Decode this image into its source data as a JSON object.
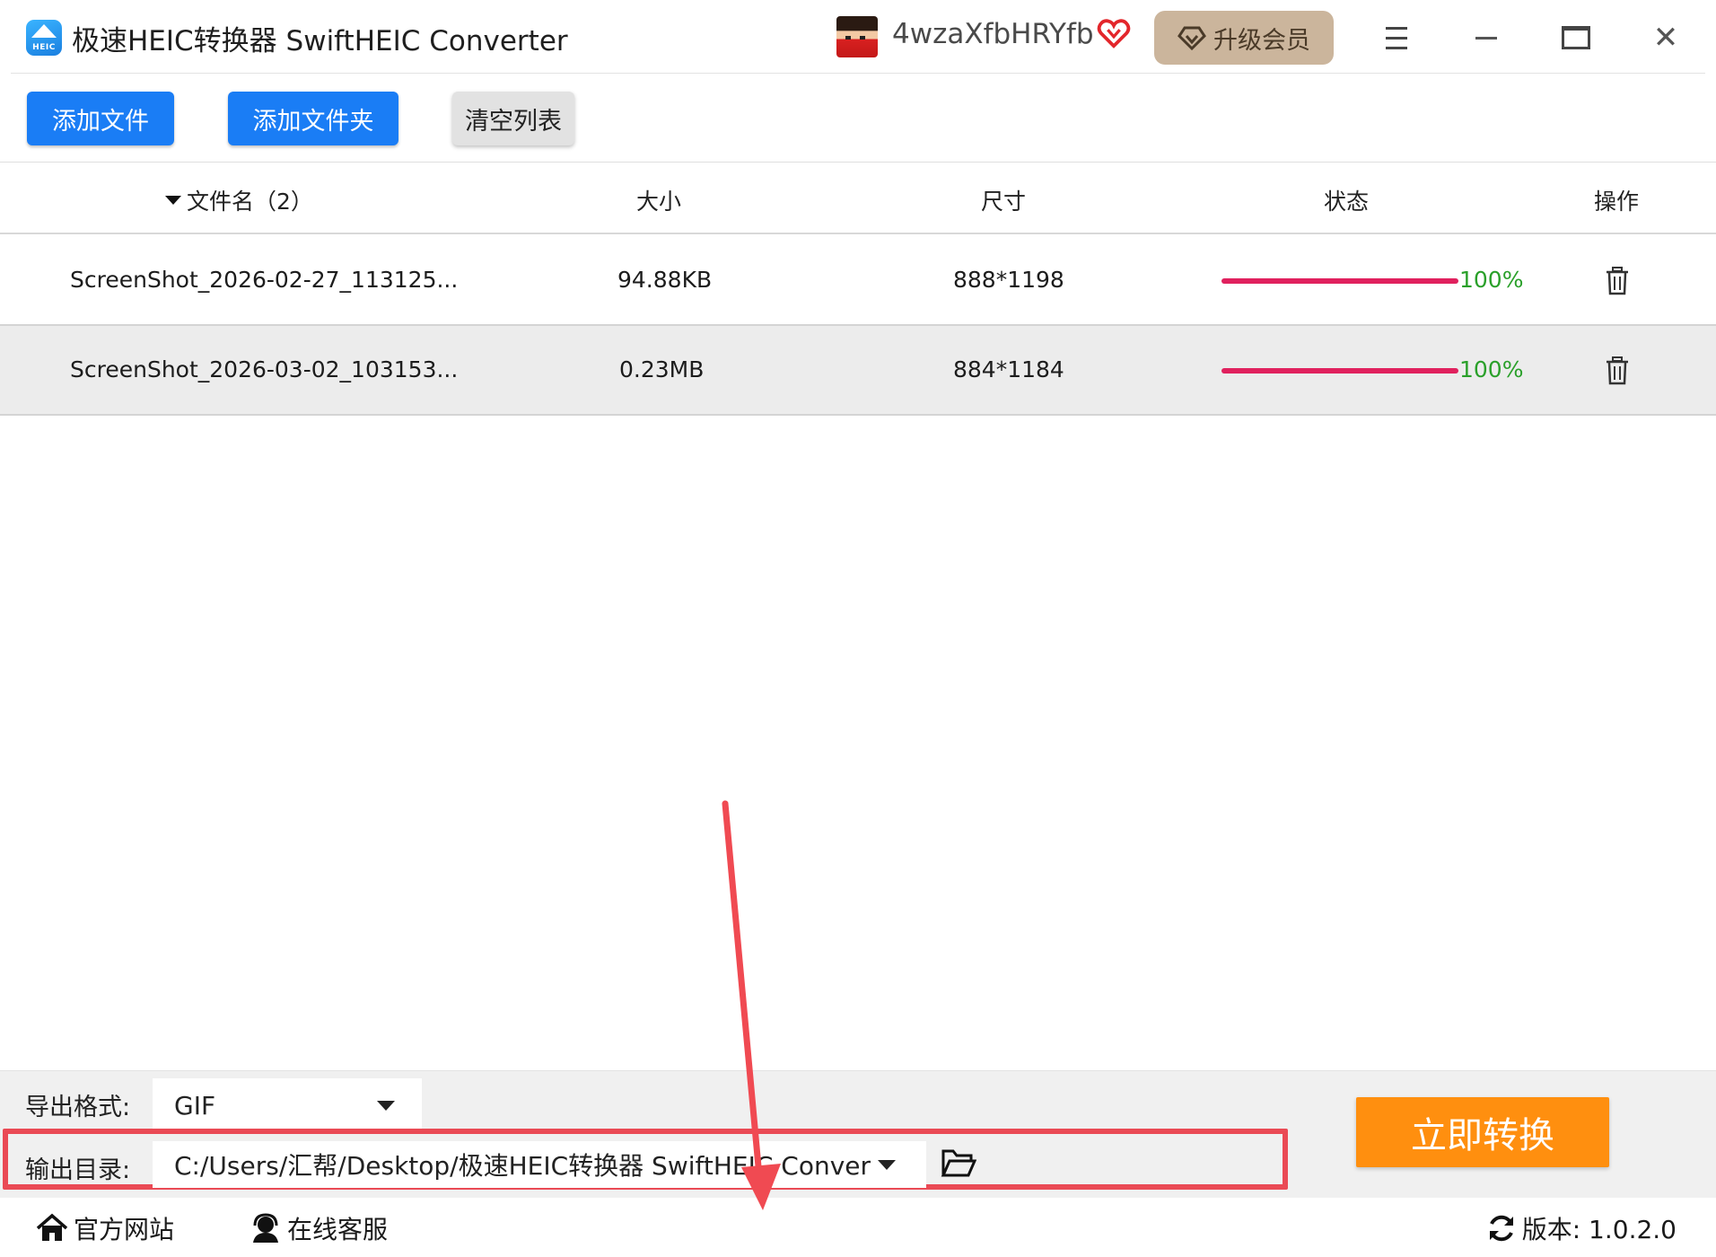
{
  "app": {
    "logo_text": "HEIC",
    "title": "极速HEIC转换器 SwiftHEIC Converter",
    "username": "4wzaXfbHRYfb",
    "upgrade_label": "升级会员"
  },
  "toolbar": {
    "add_file": "添加文件",
    "add_folder": "添加文件夹",
    "clear_list": "清空列表"
  },
  "table": {
    "headers": {
      "filename": "文件名（2）",
      "size": "大小",
      "dimensions": "尺寸",
      "status": "状态",
      "action": "操作"
    },
    "rows": [
      {
        "filename": "ScreenShot_2026-02-27_113125...",
        "size": "94.88KB",
        "dimensions": "888*1198",
        "progress": "100%"
      },
      {
        "filename": "ScreenShot_2026-03-02_103153...",
        "size": "0.23MB",
        "dimensions": "884*1184",
        "progress": "100%"
      }
    ]
  },
  "bottom": {
    "format_label": "导出格式:",
    "format_value": "GIF",
    "output_label": "输出目录:",
    "output_path": "C:/Users/汇帮/Desktop/极速HEIC转换器 SwiftHEIC Conver",
    "convert_label": "立即转换"
  },
  "footer": {
    "website": "官方网站",
    "support": "在线客服",
    "version": "版本:  1.0.2.0"
  },
  "colors": {
    "primary_blue": "#1a7df5",
    "convert_orange": "#ff8f0f",
    "progress_pink": "#e0215e",
    "percent_green": "#2aa02a",
    "highlight_red": "#ea4a55",
    "upgrade_gold": "#cbb59c"
  },
  "icons": {
    "menu": "hamburger-icon",
    "minimize": "minimize-icon",
    "maximize": "maximize-icon",
    "close": "close-icon",
    "delete": "trash-icon",
    "folder": "folder-open-icon",
    "home": "home-icon",
    "support": "headset-icon",
    "refresh": "refresh-icon"
  }
}
